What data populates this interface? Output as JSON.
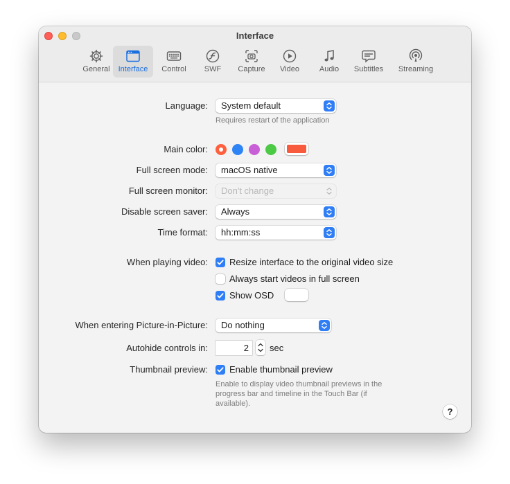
{
  "window": {
    "title": "Interface"
  },
  "tabs": [
    {
      "label": "General",
      "icon": "gear-icon"
    },
    {
      "label": "Interface",
      "icon": "window-icon",
      "active": true
    },
    {
      "label": "Control",
      "icon": "keyboard-icon"
    },
    {
      "label": "SWF",
      "icon": "flash-icon"
    },
    {
      "label": "Capture",
      "icon": "camera-icon"
    },
    {
      "label": "Video",
      "icon": "play-icon"
    },
    {
      "label": "Audio",
      "icon": "music-note-icon"
    },
    {
      "label": "Subtitles",
      "icon": "speech-bubble-icon"
    },
    {
      "label": "Streaming",
      "icon": "broadcast-icon"
    }
  ],
  "settings": {
    "language": {
      "label": "Language:",
      "value": "System default",
      "hint": "Requires restart of the application"
    },
    "main_color": {
      "label": "Main color:",
      "options": [
        "#ff5f3c",
        "#2f84f5",
        "#c95fd6",
        "#4cc945"
      ],
      "selected": "#ff5f3c",
      "well_color": "#f75a3d"
    },
    "full_screen_mode": {
      "label": "Full screen mode:",
      "value": "macOS native"
    },
    "full_screen_monitor": {
      "label": "Full screen monitor:",
      "value": "Don't change",
      "disabled": true
    },
    "disable_screen_saver": {
      "label": "Disable screen saver:",
      "value": "Always"
    },
    "time_format": {
      "label": "Time format:",
      "value": "hh:mm:ss"
    },
    "when_playing_video": {
      "label": "When playing video:",
      "resize": {
        "label": "Resize interface to the original video size",
        "checked": true
      },
      "fullscreen": {
        "label": "Always start videos in full screen",
        "checked": false
      },
      "osd": {
        "label": "Show OSD",
        "checked": true,
        "color": "#ffffff"
      }
    },
    "pip": {
      "label": "When entering Picture-in-Picture:",
      "value": "Do nothing"
    },
    "autohide": {
      "label": "Autohide controls in:",
      "value": "2",
      "unit": "sec"
    },
    "thumbnail": {
      "label": "Thumbnail preview:",
      "checkbox_label": "Enable thumbnail preview",
      "checked": true,
      "hint_lines": [
        "Enable to display video thumbnail previews in the",
        "progress bar and timeline in the Touch Bar (if",
        "available)."
      ]
    }
  },
  "help": {
    "label": "?"
  }
}
